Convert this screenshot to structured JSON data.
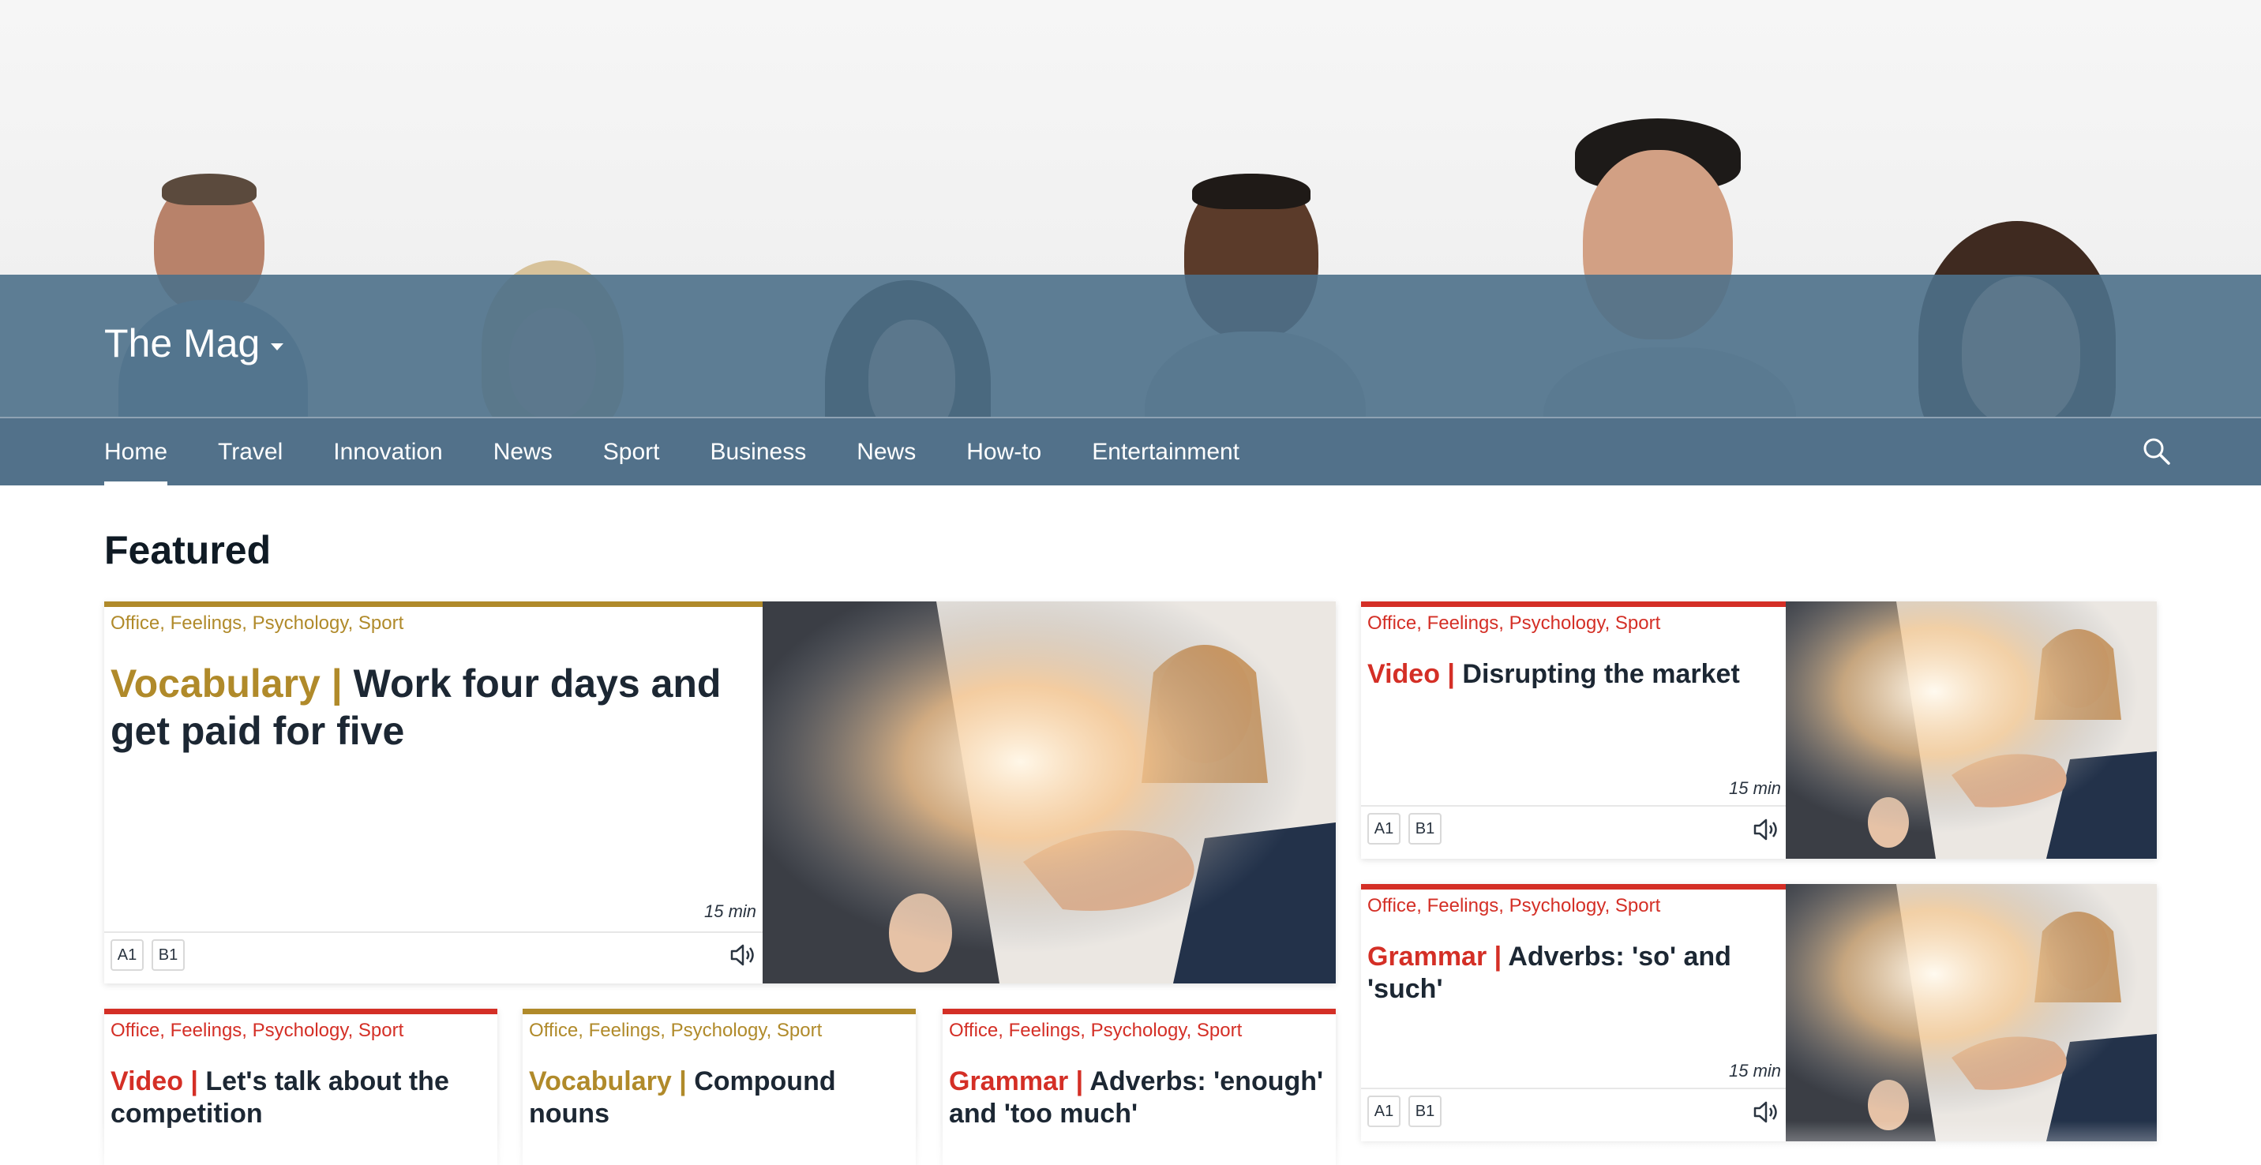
{
  "brand": {
    "title": "The Mag"
  },
  "nav": {
    "items": [
      {
        "label": "Home"
      },
      {
        "label": "Travel"
      },
      {
        "label": "Innovation"
      },
      {
        "label": "News"
      },
      {
        "label": "Sport"
      },
      {
        "label": "Business"
      },
      {
        "label": "News"
      },
      {
        "label": "How-to"
      },
      {
        "label": "Entertainment"
      }
    ],
    "active_index": 0,
    "search_icon": "search-icon"
  },
  "featured": {
    "title": "Featured",
    "cards": [
      {
        "tags": "Office, Feelings, Psychology, Sport",
        "kind": "Vocabulary",
        "title": "Work four days and get paid for five",
        "duration": "15 min",
        "levels": [
          "A1",
          "B1"
        ],
        "accent": "#b08a2a"
      },
      {
        "tags": "Office, Feelings, Psychology, Sport",
        "kind": "Video",
        "title": "Disrupting the market",
        "duration": "15 min",
        "levels": [
          "A1",
          "B1"
        ],
        "accent": "#d42f26"
      },
      {
        "tags": "Office, Feelings, Psychology, Sport",
        "kind": "Grammar",
        "title": "Adverbs: 'so' and 'such'",
        "duration": "15 min",
        "levels": [
          "A1",
          "B1"
        ],
        "accent": "#d42f26"
      },
      {
        "tags": "Office, Feelings, Psychology, Sport",
        "kind": "Video",
        "title": "Let's talk about the competition",
        "accent": "#d42f26"
      },
      {
        "tags": "Office, Feelings, Psychology, Sport",
        "kind": "Vocabulary",
        "title": "Compound nouns",
        "accent": "#b08a2a"
      },
      {
        "tags": "Office, Feelings, Psychology, Sport",
        "kind": "Grammar",
        "title": "Adverbs: 'enough' and 'too much'",
        "accent": "#d42f26"
      }
    ]
  },
  "colors": {
    "nav": "#52718a",
    "gold": "#b08a2a",
    "red": "#d42f26"
  }
}
